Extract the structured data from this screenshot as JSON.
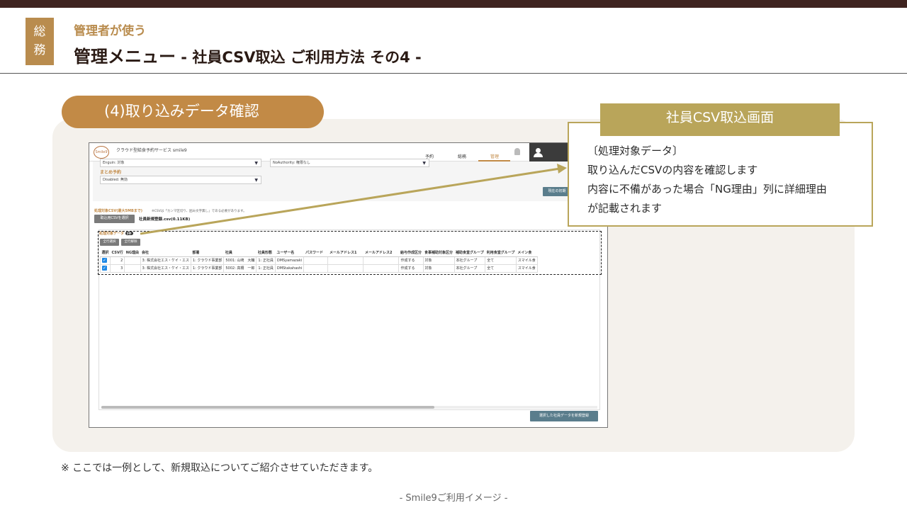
{
  "header": {
    "badge_line1": "総",
    "badge_line2": "務",
    "subtitle": "管理者が使う",
    "title_main": "管理メニュー",
    "title_sub": " - 社員CSV取込 ご利用方法 その4 -"
  },
  "step": {
    "label": "(4)取り込みデータ確認"
  },
  "callout": {
    "heading": "社員CSV取込画面",
    "line1": "〔処理対象データ〕",
    "line2": "取り込んだCSVの内容を確認します",
    "line3": "内容に不備があった場合「NG理由」列に詳細理由",
    "line4": "が記載されます"
  },
  "app": {
    "logo": "Smile9",
    "name": "クラウド型給食予約サービス smile9",
    "nav": [
      "予約",
      "総務",
      "管理"
    ],
    "form": {
      "select1": "Enguin: 対象",
      "select2": "NoAuthority: 権限なし",
      "group_label": "まとめ予約",
      "select3": "Disabled: 無効",
      "reset_button": "現在の初期"
    },
    "csv_label": "処理対象CSV(最大5MBまで)",
    "csv_note": "※CSVは「カンマ区切り、囲み文字無し」である必要があります。",
    "choose_button": "取込用CSVを選択",
    "file_name": "社員新規登録.csv(0.11KB)",
    "data_label": "処理対象データ",
    "data_count": "2件",
    "select_all": "全行選択",
    "deselect_all": "全行解除",
    "columns": [
      "選択",
      "CSV行",
      "NG理由",
      "会社",
      "部署",
      "社員",
      "社員形態",
      "ユーザー名",
      "パスワード",
      "メールアドレス1",
      "メールアドレス2",
      "給与作成区分",
      "食事補助対象区分",
      "補助食堂グループ",
      "利用食堂グループ",
      "メイン食"
    ],
    "rows": [
      [
        "✓",
        "2",
        "",
        "3: 株式会社エス・ケイ・エス",
        "1: クラウド事業部",
        "5001: 山崎　大輔",
        "1: 正社員",
        "DMSyamazaki",
        "",
        "",
        "",
        "作成する",
        "対象",
        "本社グループ",
        "全て",
        "スマイル食"
      ],
      [
        "✓",
        "3",
        "",
        "3: 株式会社エス・ケイ・エス",
        "1: クラウド事業部",
        "5002: 高橋　一郎",
        "1: 正社員",
        "DMStakahashi",
        "",
        "",
        "",
        "作成する",
        "対象",
        "本社グループ",
        "全て",
        "スマイル食"
      ]
    ],
    "register_button": "選択した社員データを新規登録"
  },
  "footnote": "※ ここでは一例として、新規取込についてご紹介させていただきます。",
  "credit": "- Smile9ご利用イメージ -"
}
